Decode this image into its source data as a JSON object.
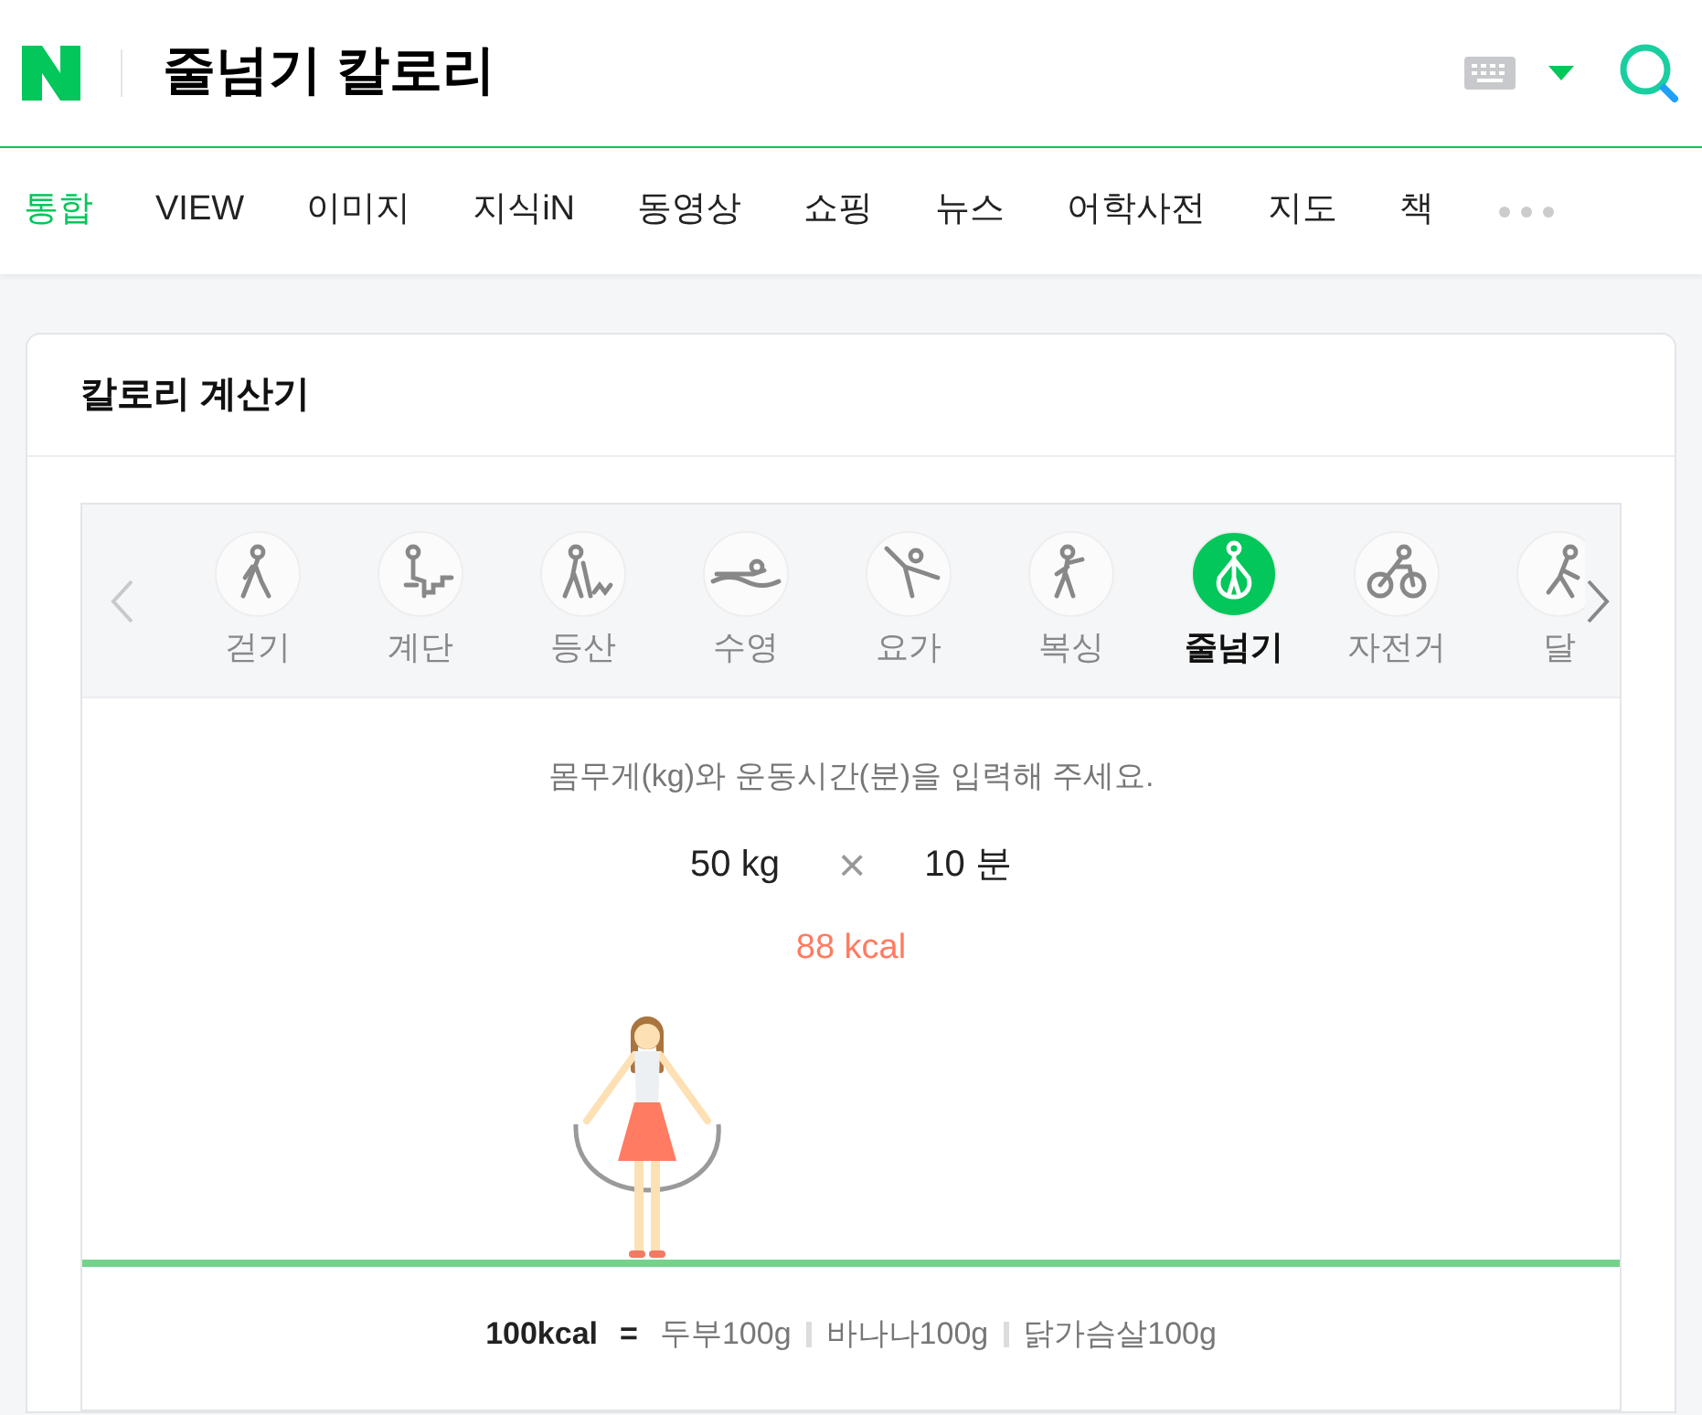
{
  "header": {
    "query": "줄넘기 칼로리"
  },
  "nav_tabs": [
    {
      "label": "통합",
      "selected": true
    },
    {
      "label": "VIEW",
      "selected": false
    },
    {
      "label": "이미지",
      "selected": false
    },
    {
      "label": "지식iN",
      "selected": false
    },
    {
      "label": "동영상",
      "selected": false
    },
    {
      "label": "쇼핑",
      "selected": false
    },
    {
      "label": "뉴스",
      "selected": false
    },
    {
      "label": "어학사전",
      "selected": false
    },
    {
      "label": "지도",
      "selected": false
    },
    {
      "label": "책",
      "selected": false
    }
  ],
  "card": {
    "title": "칼로리 계산기",
    "activities": [
      {
        "kind": "walk",
        "label": "걷기",
        "selected": false
      },
      {
        "kind": "stairs",
        "label": "계단",
        "selected": false
      },
      {
        "kind": "hike",
        "label": "등산",
        "selected": false
      },
      {
        "kind": "swim",
        "label": "수영",
        "selected": false
      },
      {
        "kind": "yoga",
        "label": "요가",
        "selected": false
      },
      {
        "kind": "boxing",
        "label": "복싱",
        "selected": false
      },
      {
        "kind": "jumprope",
        "label": "줄넘기",
        "selected": true
      },
      {
        "kind": "cycle",
        "label": "자전거",
        "selected": false
      },
      {
        "kind": "run",
        "label": "달",
        "selected": false
      }
    ],
    "instruction": "몸무게(kg)와 운동시간(분)을 입력해 주세요.",
    "weight": {
      "value": "50",
      "unit": "kg"
    },
    "operator": "×",
    "duration": {
      "value": "10",
      "unit": "분"
    },
    "result": {
      "value": "88",
      "unit": "kcal"
    },
    "equivalence": {
      "label": "100kcal",
      "equals": "=",
      "foods": [
        "두부100g",
        "바나나100g",
        "닭가슴살100g"
      ]
    }
  }
}
